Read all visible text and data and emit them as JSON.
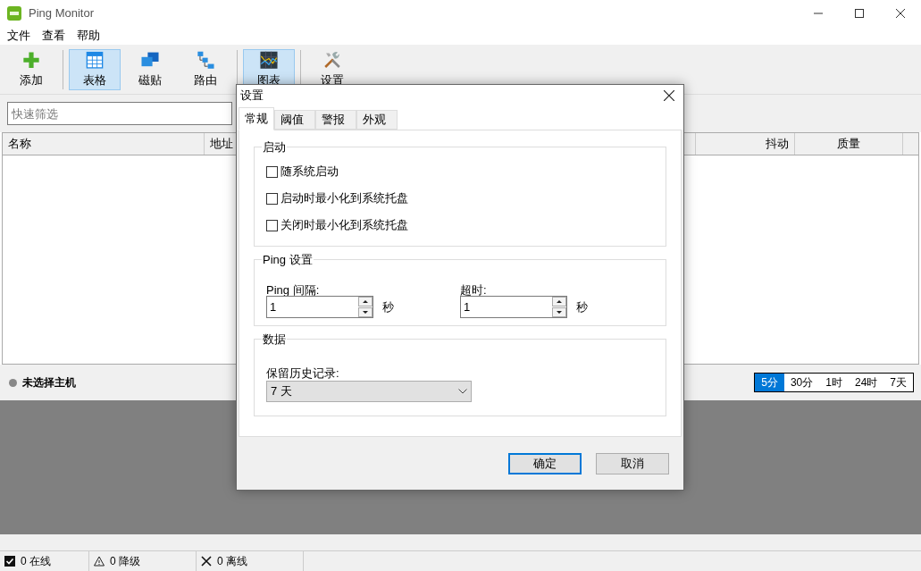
{
  "window": {
    "title": "Ping Monitor"
  },
  "menu": [
    "文件",
    "查看",
    "帮助"
  ],
  "toolbar": [
    {
      "label": "添加",
      "selected": false
    },
    {
      "label": "表格",
      "selected": true
    },
    {
      "label": "磁贴",
      "selected": false
    },
    {
      "label": "路由",
      "selected": false
    },
    {
      "label": "图表",
      "selected": true
    },
    {
      "label": "设置",
      "selected": false
    }
  ],
  "filter": {
    "placeholder": "快速筛选"
  },
  "table": {
    "columns": [
      "名称",
      "地址",
      "抖动",
      "质量"
    ]
  },
  "host": {
    "label": "未选择主机"
  },
  "ranges": [
    {
      "label": "5分",
      "selected": true
    },
    {
      "label": "30分",
      "selected": false
    },
    {
      "label": "1时",
      "selected": false
    },
    {
      "label": "24时",
      "selected": false
    },
    {
      "label": "7天",
      "selected": false
    }
  ],
  "status_bar": [
    {
      "kind": "check",
      "text": "0 在线"
    },
    {
      "kind": "warn",
      "text": "0 降级"
    },
    {
      "kind": "cross",
      "text": "0 离线"
    }
  ],
  "dialog": {
    "title": "设置",
    "tabs": [
      {
        "label": "常规",
        "selected": true
      },
      {
        "label": "阈值",
        "selected": false
      },
      {
        "label": "警报",
        "selected": false
      },
      {
        "label": "外观",
        "selected": false
      }
    ],
    "startup": {
      "title": "启动",
      "options": [
        {
          "label": "随系统启动",
          "checked": false
        },
        {
          "label": "启动时最小化到系统托盘",
          "checked": false
        },
        {
          "label": "关闭时最小化到系统托盘",
          "checked": false
        }
      ]
    },
    "ping": {
      "title": "Ping 设置",
      "fields": [
        {
          "label": "Ping 间隔:",
          "value": "1",
          "unit": "秒"
        },
        {
          "label": "超时:",
          "value": "1",
          "unit": "秒"
        }
      ]
    },
    "data": {
      "title": "数据",
      "label": "保留历史记录:",
      "value": "7 天"
    },
    "buttons": [
      {
        "label": "确定",
        "default": true
      },
      {
        "label": "取消",
        "default": false
      }
    ]
  }
}
